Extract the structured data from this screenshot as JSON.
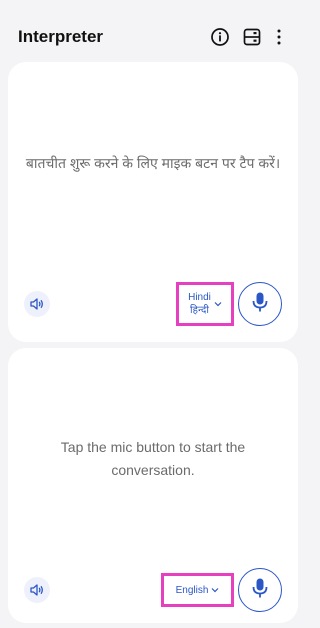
{
  "app": {
    "title": "Interpreter"
  },
  "header_icons": [
    "info-icon",
    "layout-icon",
    "more-icon"
  ],
  "top_panel": {
    "prompt": "बातचीत शुरू करने के लिए माइक बटन पर टैप करें।",
    "language_en": "Hindi",
    "language_native": "हिन्दी"
  },
  "bottom_panel": {
    "prompt": "Tap the mic button to start the conversation.",
    "language": "English"
  },
  "colors": {
    "accent": "#2a56c6",
    "highlight": "#e63fbf",
    "background": "#f4f4f6"
  }
}
